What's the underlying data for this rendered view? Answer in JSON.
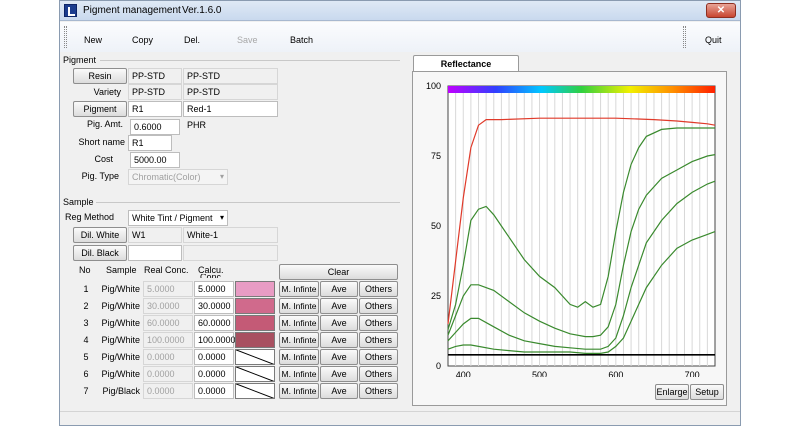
{
  "window": {
    "title": "Pigment management",
    "version": "Ver.1.6.0",
    "close_glyph": "✕"
  },
  "toolbar": {
    "new": "New",
    "copy": "Copy",
    "del": "Del.",
    "save": "Save",
    "batch": "Batch",
    "quit": "Quit"
  },
  "pigment": {
    "section": "Pigment",
    "resin_btn": "Resin",
    "resin_code": "PP-STD",
    "resin_name": "PP-STD",
    "variety_label": "Variety",
    "variety_code": "PP-STD",
    "variety_name": "PP-STD",
    "pigment_btn": "Pigment",
    "pigment_code": "R1",
    "pigment_name": "Red-1",
    "amt_label": "Pig. Amt.",
    "amt_value": "0.6000",
    "amt_unit": "PHR",
    "short_label": "Short name",
    "short_value": "R1",
    "cost_label": "Cost",
    "cost_value": "5000.00",
    "type_label": "Pig. Type",
    "type_value": "Chromatic(Color)"
  },
  "sample": {
    "section": "Sample",
    "reg_label": "Reg Method",
    "reg_value": "White Tint / Pigment",
    "dil_white_btn": "Dil. White",
    "dil_white_code": "W1",
    "dil_white_name": "White-1",
    "dil_black_btn": "Dil. Black",
    "headers": {
      "no": "No",
      "sample": "Sample",
      "real": "Real Conc.",
      "calcu": "Calcu.",
      "calcu2": "Conc."
    },
    "clear_btn": "Clear",
    "rows": [
      {
        "no": "1",
        "sample": "Pig/White",
        "real": "5.0000",
        "calc": "5.0000",
        "color": "#e89cc4",
        "minf": "M. Infinte",
        "ave": "Ave",
        "others": "Others"
      },
      {
        "no": "2",
        "sample": "Pig/White",
        "real": "30.0000",
        "calc": "30.0000",
        "color": "#d06a8c",
        "minf": "M. Infinte",
        "ave": "Ave",
        "others": "Others"
      },
      {
        "no": "3",
        "sample": "Pig/White",
        "real": "60.0000",
        "calc": "60.0000",
        "color": "#c45a76",
        "minf": "M. Infinte",
        "ave": "Ave",
        "others": "Others"
      },
      {
        "no": "4",
        "sample": "Pig/White",
        "real": "100.0000",
        "calc": "100.0000",
        "color": "#a85060",
        "minf": "M. Infinte",
        "ave": "Ave",
        "others": "Others"
      },
      {
        "no": "5",
        "sample": "Pig/White",
        "real": "0.0000",
        "calc": "0.0000",
        "color": "",
        "minf": "M. Infinte",
        "ave": "Ave",
        "others": "Others"
      },
      {
        "no": "6",
        "sample": "Pig/White",
        "real": "0.0000",
        "calc": "0.0000",
        "color": "",
        "minf": "M. Infinte",
        "ave": "Ave",
        "others": "Others"
      },
      {
        "no": "7",
        "sample": "Pig/Black",
        "real": "0.0000",
        "calc": "0.0000",
        "color": "",
        "minf": "M. Infinte",
        "ave": "Ave",
        "others": "Others"
      }
    ]
  },
  "chart_tab": "Reflectance",
  "chart_buttons": {
    "enlarge": "Enlarge",
    "setup": "Setup"
  },
  "chart_data": {
    "type": "line",
    "title": "",
    "xlabel": "",
    "ylabel": "",
    "xlim": [
      380,
      730
    ],
    "ylim": [
      0,
      100
    ],
    "xticks": [
      400,
      500,
      600,
      700
    ],
    "yticks": [
      0,
      25,
      50,
      75,
      100
    ],
    "grid": true,
    "spectrum_bar": true,
    "series": [
      {
        "color": "#e03a2a",
        "x": [
          380,
          400,
          410,
          420,
          430,
          450,
          500,
          550,
          600,
          650,
          680,
          700,
          720,
          730
        ],
        "y": [
          15,
          60,
          78,
          86,
          88,
          88,
          88.5,
          88.5,
          88.5,
          88,
          87.5,
          87,
          86.5,
          86
        ]
      },
      {
        "color": "#3a8a2e",
        "x": [
          380,
          390,
          400,
          410,
          420,
          430,
          440,
          450,
          460,
          480,
          500,
          520,
          540,
          550,
          560,
          570,
          580,
          590,
          600,
          610,
          620,
          630,
          640,
          660,
          680,
          700,
          720,
          730
        ],
        "y": [
          13,
          22,
          36,
          52,
          56,
          57,
          54,
          50,
          46,
          38,
          32,
          28,
          22,
          21,
          23,
          21,
          22,
          32,
          48,
          62,
          72,
          78,
          82,
          84.5,
          85,
          85,
          85,
          85
        ]
      },
      {
        "color": "#3a8a2e",
        "x": [
          380,
          390,
          400,
          410,
          420,
          440,
          460,
          480,
          500,
          520,
          540,
          560,
          570,
          580,
          590,
          600,
          610,
          620,
          630,
          640,
          660,
          680,
          700,
          720,
          730
        ],
        "y": [
          11,
          18,
          25,
          29,
          29,
          27,
          23,
          19,
          16,
          13.5,
          11.5,
          10.5,
          10.5,
          11,
          14,
          22,
          36,
          48,
          56,
          61,
          67,
          70,
          73,
          75,
          75.5
        ]
      },
      {
        "color": "#3a8a2e",
        "x": [
          380,
          390,
          400,
          410,
          420,
          440,
          460,
          480,
          500,
          520,
          540,
          560,
          580,
          590,
          600,
          610,
          620,
          630,
          640,
          660,
          680,
          700,
          720,
          730
        ],
        "y": [
          9,
          12,
          15,
          17,
          17,
          14,
          11,
          9,
          8,
          7,
          6.5,
          6,
          6,
          7,
          10,
          18,
          28,
          36,
          44,
          52,
          58,
          62,
          65,
          66
        ]
      },
      {
        "color": "#3a8a2e",
        "x": [
          380,
          390,
          400,
          410,
          420,
          440,
          460,
          480,
          500,
          520,
          540,
          560,
          580,
          590,
          600,
          610,
          620,
          630,
          640,
          660,
          680,
          700,
          720,
          730
        ],
        "y": [
          6,
          7,
          7.5,
          7.5,
          7,
          6,
          5.5,
          5,
          5,
          5,
          5,
          4.5,
          4.5,
          5,
          7,
          10,
          16,
          22,
          28,
          36,
          42,
          45,
          47,
          48
        ]
      },
      {
        "color": "#000000",
        "x": [
          380,
          730
        ],
        "y": [
          4,
          4
        ]
      }
    ]
  }
}
